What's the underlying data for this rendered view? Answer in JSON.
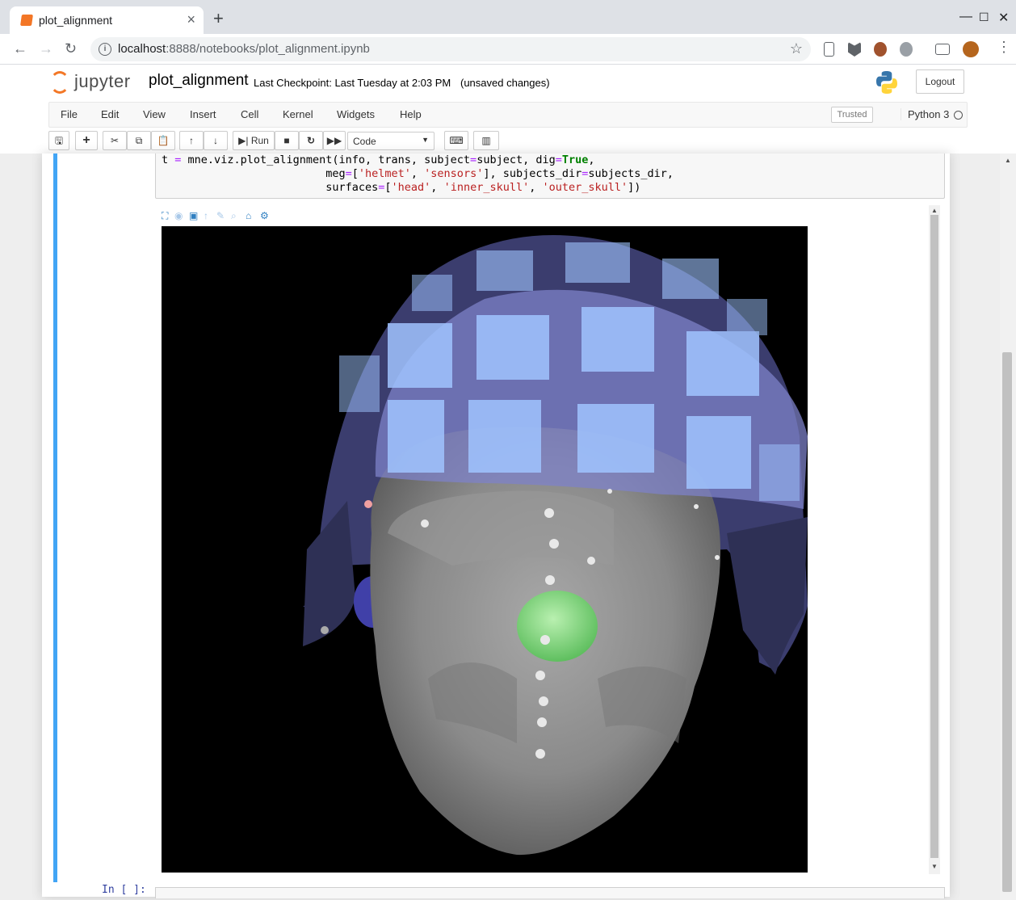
{
  "browser": {
    "tab_title": "plot_alignment",
    "url_host": "localhost",
    "url_rest": ":8888/notebooks/plot_alignment.ipynb",
    "accent": "#f37626"
  },
  "header": {
    "logo_text": "jupyter",
    "notebook_name": "plot_alignment",
    "checkpoint": "Last Checkpoint: Last Tuesday at 2:03 PM",
    "unsaved": "(unsaved changes)",
    "logout": "Logout"
  },
  "menu": {
    "items": [
      "File",
      "Edit",
      "View",
      "Insert",
      "Cell",
      "Kernel",
      "Widgets",
      "Help"
    ],
    "trusted": "Trusted",
    "kernel": "Python 3"
  },
  "toolbar": {
    "run_label": "Run",
    "cell_type": "Code"
  },
  "cell": {
    "code_lines": [
      {
        "t": "t",
        "a": " ",
        "b": "=",
        "c": " mne.viz.plot_alignment(info, trans, subject",
        "d": "=",
        "e": "subject, dig",
        "f": "=",
        "g": "True",
        "h": ","
      },
      {
        "indent": "                         ",
        "p1": "meg",
        "eq1": "=",
        "p2": "[",
        "s1": "'helmet'",
        "p3": ", ",
        "s2": "'sensors'",
        "p4": "], subjects_dir",
        "eq2": "=",
        "p5": "subjects_dir,"
      },
      {
        "indent": "                         ",
        "p1": "surfaces",
        "eq1": "=",
        "p2": "[",
        "s1": "'head'",
        "p3": ", ",
        "s2": "'inner_skull'",
        "p4": ", ",
        "s3": "'outer_skull'",
        "p5": "])"
      }
    ],
    "next_prompt": "In [ ]:"
  },
  "colors": {
    "cell_selected": "#42a5f5",
    "head": "#8c8c8c",
    "helmet": "#7d82c8",
    "sensor": "#a0c4ff",
    "nasion": "#7ad67a"
  }
}
